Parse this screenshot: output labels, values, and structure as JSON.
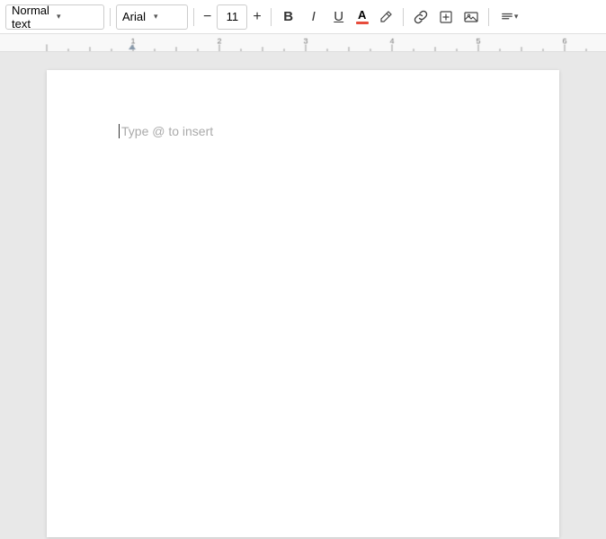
{
  "toolbar": {
    "style_label": "Normal text",
    "style_chevron": "▾",
    "font_label": "Arial",
    "font_chevron": "▾",
    "font_size": "11",
    "minus_label": "−",
    "plus_label": "+",
    "bold_label": "B",
    "italic_label": "I",
    "underline_label": "U",
    "font_color_label": "A",
    "highlight_color_label": "A",
    "link_icon": "link",
    "insert_image_icon": "insert-image",
    "more_icon": "more",
    "align_icon": "align",
    "align_chevron": "▾"
  },
  "ruler": {
    "markers": [
      "1",
      "1",
      "2",
      "3",
      "4",
      "5"
    ]
  },
  "document": {
    "placeholder": "Type @ to insert"
  },
  "colors": {
    "font_underline": "#e74c3c",
    "toolbar_bg": "#ffffff",
    "page_bg": "#ffffff",
    "area_bg": "#e8e8e8"
  }
}
